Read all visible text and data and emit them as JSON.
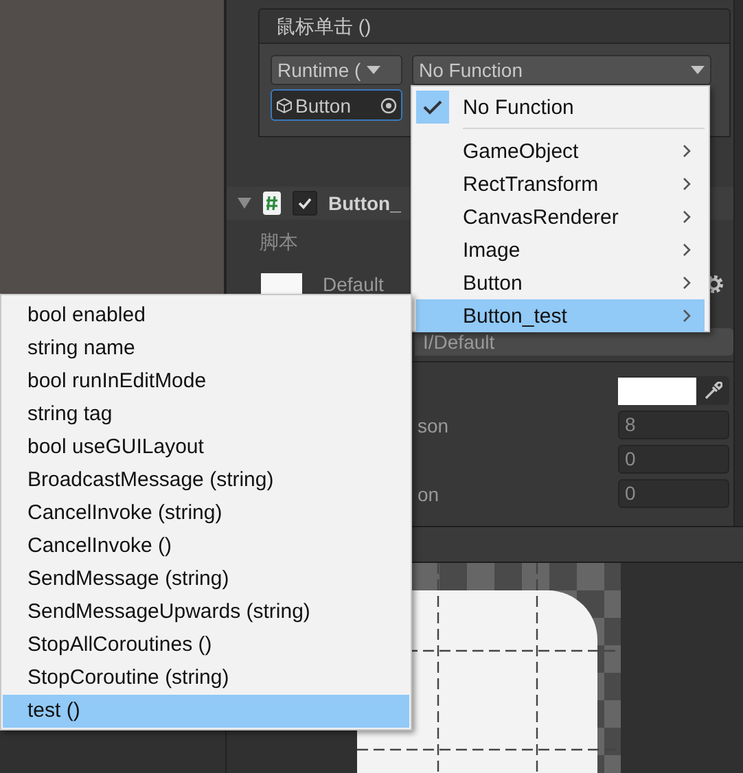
{
  "event": {
    "title": "鼠标单击 ()",
    "runtime": "Runtime (",
    "function": "No Function",
    "target": "Button"
  },
  "component": {
    "title": "Button_",
    "enabled": true,
    "script_label": "脚本",
    "material": "Default",
    "shader": "I/Default"
  },
  "properties": [
    {
      "kind": "color"
    },
    {
      "kind": "number",
      "label": "son",
      "value": "8"
    },
    {
      "kind": "number",
      "value": "0"
    },
    {
      "kind": "number",
      "label": "on",
      "value": "0"
    }
  ],
  "function_menu": {
    "items": [
      {
        "label": "No Function",
        "checked": true,
        "selected": false,
        "submenu": false
      },
      {
        "label": "GameObject",
        "checked": false,
        "selected": false,
        "submenu": true
      },
      {
        "label": "RectTransform",
        "checked": false,
        "selected": false,
        "submenu": true
      },
      {
        "label": "CanvasRenderer",
        "checked": false,
        "selected": false,
        "submenu": true
      },
      {
        "label": "Image",
        "checked": false,
        "selected": false,
        "submenu": true
      },
      {
        "label": "Button",
        "checked": false,
        "selected": false,
        "submenu": true
      },
      {
        "label": "Button_test",
        "checked": false,
        "selected": true,
        "submenu": true
      }
    ]
  },
  "method_menu": {
    "items": [
      {
        "label": "bool enabled",
        "selected": false
      },
      {
        "label": "string name",
        "selected": false
      },
      {
        "label": "bool runInEditMode",
        "selected": false
      },
      {
        "label": "string tag",
        "selected": false
      },
      {
        "label": "bool useGUILayout",
        "selected": false
      },
      {
        "label": "BroadcastMessage (string)",
        "selected": false
      },
      {
        "label": "CancelInvoke (string)",
        "selected": false
      },
      {
        "label": "CancelInvoke ()",
        "selected": false
      },
      {
        "label": "SendMessage (string)",
        "selected": false
      },
      {
        "label": "SendMessageUpwards (string)",
        "selected": false
      },
      {
        "label": "StopAllCoroutines ()",
        "selected": false
      },
      {
        "label": "StopCoroutine (string)",
        "selected": false
      },
      {
        "label": "test ()",
        "selected": true
      }
    ]
  }
}
